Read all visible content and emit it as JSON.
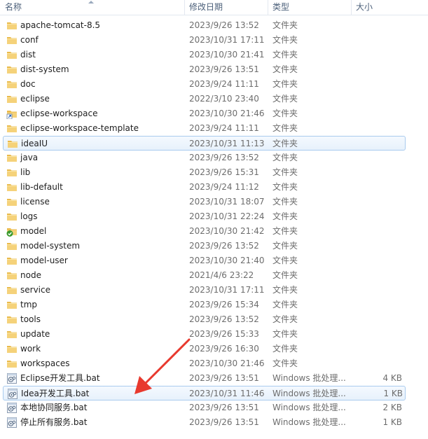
{
  "columns": {
    "name": "名称",
    "date": "修改日期",
    "type": "类型",
    "size": "大小"
  },
  "colors": {
    "folder": "#f0c75a",
    "selection_border": "#a9cbee",
    "arrow": "#e8392e"
  },
  "files": [
    {
      "name": "apache-tomcat-8.5",
      "date": "2023/9/26 13:52",
      "type": "文件夹",
      "size": "",
      "icon": "folder-icon"
    },
    {
      "name": "conf",
      "date": "2023/10/31 17:11",
      "type": "文件夹",
      "size": "",
      "icon": "folder-icon"
    },
    {
      "name": "dist",
      "date": "2023/10/30 21:41",
      "type": "文件夹",
      "size": "",
      "icon": "folder-icon"
    },
    {
      "name": "dist-system",
      "date": "2023/9/26 13:51",
      "type": "文件夹",
      "size": "",
      "icon": "folder-icon"
    },
    {
      "name": "doc",
      "date": "2023/9/24 11:11",
      "type": "文件夹",
      "size": "",
      "icon": "folder-icon"
    },
    {
      "name": "eclipse",
      "date": "2022/3/10 23:40",
      "type": "文件夹",
      "size": "",
      "icon": "folder-icon"
    },
    {
      "name": "eclipse-workspace",
      "date": "2023/10/30 21:46",
      "type": "文件夹",
      "size": "",
      "icon": "folder-shortcut-icon"
    },
    {
      "name": "eclipse-workspace-template",
      "date": "2023/9/24 11:11",
      "type": "文件夹",
      "size": "",
      "icon": "folder-icon"
    },
    {
      "name": "ideaIU",
      "date": "2023/10/31 11:13",
      "type": "文件夹",
      "size": "",
      "icon": "folder-icon",
      "selected": true
    },
    {
      "name": "java",
      "date": "2023/9/26 13:52",
      "type": "文件夹",
      "size": "",
      "icon": "folder-icon"
    },
    {
      "name": "lib",
      "date": "2023/9/26 15:31",
      "type": "文件夹",
      "size": "",
      "icon": "folder-icon"
    },
    {
      "name": "lib-default",
      "date": "2023/9/24 11:12",
      "type": "文件夹",
      "size": "",
      "icon": "folder-icon"
    },
    {
      "name": "license",
      "date": "2023/10/31 18:07",
      "type": "文件夹",
      "size": "",
      "icon": "folder-icon"
    },
    {
      "name": "logs",
      "date": "2023/10/31 22:24",
      "type": "文件夹",
      "size": "",
      "icon": "folder-icon"
    },
    {
      "name": "model",
      "date": "2023/10/30 21:42",
      "type": "文件夹",
      "size": "",
      "icon": "folder-synced-icon"
    },
    {
      "name": "model-system",
      "date": "2023/9/26 13:52",
      "type": "文件夹",
      "size": "",
      "icon": "folder-icon"
    },
    {
      "name": "model-user",
      "date": "2023/10/30 21:40",
      "type": "文件夹",
      "size": "",
      "icon": "folder-icon"
    },
    {
      "name": "node",
      "date": "2021/4/6 23:22",
      "type": "文件夹",
      "size": "",
      "icon": "folder-icon"
    },
    {
      "name": "service",
      "date": "2023/10/31 17:11",
      "type": "文件夹",
      "size": "",
      "icon": "folder-icon"
    },
    {
      "name": "tmp",
      "date": "2023/9/26 15:34",
      "type": "文件夹",
      "size": "",
      "icon": "folder-icon"
    },
    {
      "name": "tools",
      "date": "2023/9/26 13:52",
      "type": "文件夹",
      "size": "",
      "icon": "folder-icon"
    },
    {
      "name": "update",
      "date": "2023/9/26 15:33",
      "type": "文件夹",
      "size": "",
      "icon": "folder-icon"
    },
    {
      "name": "work",
      "date": "2023/9/26 16:30",
      "type": "文件夹",
      "size": "",
      "icon": "folder-icon"
    },
    {
      "name": "workspaces",
      "date": "2023/10/30 21:46",
      "type": "文件夹",
      "size": "",
      "icon": "folder-icon"
    },
    {
      "name": "Eclipse开发工具.bat",
      "date": "2023/9/26 13:51",
      "type": "Windows 批处理...",
      "size": "4 KB",
      "icon": "batch-file-icon"
    },
    {
      "name": "Idea开发工具.bat",
      "date": "2023/10/31 11:46",
      "type": "Windows 批处理...",
      "size": "1 KB",
      "icon": "batch-file-icon",
      "selected": true
    },
    {
      "name": "本地协同服务.bat",
      "date": "2023/9/26 13:51",
      "type": "Windows 批处理...",
      "size": "2 KB",
      "icon": "batch-file-icon"
    },
    {
      "name": "停止所有服务.bat",
      "date": "2023/9/26 13:51",
      "type": "Windows 批处理...",
      "size": "1 KB",
      "icon": "batch-file-icon"
    }
  ]
}
